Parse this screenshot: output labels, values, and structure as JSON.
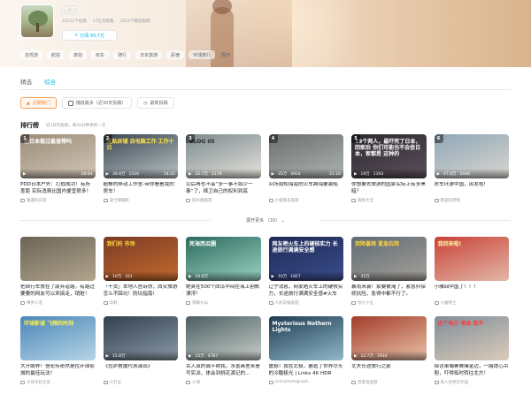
{
  "header": {
    "title": "旅游",
    "stats": [
      "10111个投稿",
      "17亿次观看",
      "1012个精选视频"
    ],
    "subscribe_label": "订阅 93.7万",
    "chips": [
      "自驾游",
      "航拍",
      "旅拍",
      "房车",
      "骑行",
      "日本旅游",
      "民宿",
      "环球旅行"
    ],
    "chips_more": "展开"
  },
  "tabs": [
    "精选",
    "综合"
  ],
  "active_tab": "综合",
  "filters": [
    "近期热门",
    "播放最多（近30天投稿）",
    "最新投稿"
  ],
  "active_filter": "近期热门",
  "section": {
    "title": "排行榜",
    "subtitle": "近3日内投稿，每30分钟更新一次"
  },
  "show_more": "展开更多 （10） ⌄",
  "rows": [
    [
      {
        "rank": "1",
        "caption": "在日本做过最值得吗",
        "views": "",
        "comments": "",
        "duration": "18:04",
        "title": "PDD日本户外：打假成功！有所差距 实际消费比国内便宜很多！",
        "uploader": "随遇的日常",
        "colors": [
          "#9c8b78",
          "#d1c7b8"
        ],
        "cap_color": "#ffffff"
      },
      {
        "rank": "2",
        "caption": "无贴床铺 自电脑工作 工作十日",
        "views": "39.9万",
        "comments": "1520",
        "duration": "14:22",
        "title": "超棒的移动工作室-带你看看我的房车！",
        "uploader": "波士顿摄影",
        "colors": [
          "#3b4650",
          "#b9c3c6"
        ],
        "cap_color": "#ffe24a"
      },
      {
        "rank": "3",
        "caption": "VLOG 05",
        "views": "32.7万",
        "comments": "1178",
        "duration": "",
        "title": "以后再也不会“多一事不如少一事”了，择卫自己的权利到底",
        "uploader": "趴趴踏旅游",
        "colors": [
          "#7b8a8f",
          "#e8e4dc"
        ],
        "cap_color": "#2a2a2a"
      },
      {
        "rank": "4",
        "caption": "",
        "views": "35万",
        "comments": "4954",
        "duration": "21:16",
        "title": "众所周知海南的火车跨海要装船",
        "uploader": "小俊要去旅游",
        "colors": [
          "#6b6f6e",
          "#aeb4b0"
        ],
        "cap_color": "#ffffff"
      },
      {
        "rank": "5",
        "caption": "19个两人，最吓死了日本，回家后 你们可能也不会信日本，家都是 这种的",
        "views": "19万",
        "comments": "1193",
        "duration": "",
        "title": "你想要去旅游的国家实际上有多黑暗？",
        "uploader": "旅程大全",
        "colors": [
          "#2c2a32",
          "#5b4f59"
        ],
        "cap_color": "#ffffff"
      },
      {
        "rank": "6",
        "caption": "",
        "views": "47.8万",
        "comments": "2046",
        "duration": "",
        "title": "房车环游中国，出发啦!",
        "uploader": "我是阿梦啊",
        "colors": [
          "#8fa7b7",
          "#d9d6cf"
        ],
        "cap_color": "#ffffff"
      }
    ],
    [
      {
        "rank": "",
        "caption": "",
        "views": "",
        "comments": "",
        "duration": "",
        "title": "把自行车放在了废弃道路，有路过要要的网友可以来搞走，销赃！",
        "uploader": "事男人老",
        "colors": [
          "#6b6456",
          "#b2a58e"
        ],
        "cap_color": "#ffffff"
      },
      {
        "rank": "",
        "caption": "我们的 市场",
        "views": "10万",
        "comments": "321",
        "duration": "",
        "title": "「干货」本地人告诉你，西安旅游怎么不踩坑！防坑指南!",
        "uploader": "华财",
        "colors": [
          "#7a3b26",
          "#c46a2d"
        ],
        "cap_color": "#ffd840"
      },
      {
        "rank": "",
        "caption": "死海西瓜圈",
        "views": "10.6万",
        "comments": "",
        "duration": "",
        "title": "她夹在500个西瓜中间在海上割默漂浮！",
        "uploader": "荣耀大山",
        "colors": [
          "#2d6b5c",
          "#9ad2c4"
        ],
        "cap_color": "#ffffff"
      },
      {
        "rank": "",
        "caption": "网友晒火车上的硬核实力 长途旅行满满安全感",
        "views": "10万",
        "comments": "1827",
        "duration": "",
        "title": "辽宁消息，网友晒火车上的硬核实力，长途旅行满满安全感#火车",
        "uploader": "人民日报旅游",
        "colors": [
          "#1e2a55",
          "#3b4d8c"
        ],
        "cap_color": "#ffffff"
      },
      {
        "rank": "",
        "caption": "突降暴雨 紧急抗险",
        "views": "35万",
        "comments": "",
        "duration": "",
        "title": "暴雨来袭！家要被淹了，紧急抖保修抗险，急得中都不行了。",
        "uploader": "你小小五",
        "colors": [
          "#5f6b72",
          "#a6a19a"
        ],
        "cap_color": "#ffd23d"
      },
      {
        "rank": "",
        "caption": "我回来啦!",
        "views": "",
        "comments": "",
        "duration": "",
        "title": "小雅回中国了！！！",
        "uploader": "小雅神士",
        "colors": [
          "#c94238",
          "#e2b7a7"
        ],
        "cap_color": "#fff1a8"
      }
    ],
    [
      {
        "rank": "",
        "caption": "环球影城 飞翔的时刻",
        "views": "",
        "comments": "",
        "duration": "",
        "title": "大开眼界！信轮传奇然是在环球影城的最佳玩法！",
        "uploader": "大领子好兄弟",
        "colors": [
          "#4a86b8",
          "#b7d5e6"
        ],
        "cap_color": "#fff14c"
      },
      {
        "rank": "",
        "caption": "",
        "views": "15.8万",
        "comments": "",
        "duration": "",
        "title": "《拉萨救援代表演出》",
        "uploader": "小钉豆",
        "colors": [
          "#32404e",
          "#8a9aa8"
        ],
        "cap_color": "#ffffff"
      },
      {
        "rank": "",
        "caption": "",
        "views": "15万",
        "comments": "4787",
        "duration": "",
        "title": "古人真的诚不欺我。水墨画里来是写实派，体会到桃花源记的...",
        "uploader": "小海",
        "colors": [
          "#4d5f63",
          "#c7cfc9"
        ],
        "cap_color": "#ffffff"
      },
      {
        "rank": "",
        "caption": "Mysterious Nothern Lights",
        "views": "",
        "comments": "",
        "duration": "",
        "title": "震撼！我在北极，邂逅了世界尽头的冷酷极光 | Links 4K HDR",
        "uploader": "Linksphotograph",
        "colors": [
          "#1f3b52",
          "#8fb8c9"
        ],
        "cap_color": "#ffffff"
      },
      {
        "rank": "",
        "caption": "",
        "views": "12.7万",
        "comments": "1934",
        "duration": "",
        "title": "丈夫长途旅行之前",
        "uploader": "百家电旅游",
        "colors": [
          "#a33c2a",
          "#e8c3a8"
        ],
        "cap_color": "#ffffff"
      },
      {
        "rank": "",
        "caption": "这个地方 根本 就不",
        "views": "",
        "comments": "",
        "duration": "",
        "title": "探访柬埔寨赛赌金边，一路提心吊胆，吓得临时转往北方！",
        "uploader": "黑人世界在外国",
        "colors": [
          "#7f8e9b",
          "#dccbb8"
        ],
        "cap_color": "#ff3e3e"
      }
    ]
  ],
  "colors": {
    "accent": "#00aeec",
    "filter_active": "#ff7f24"
  }
}
